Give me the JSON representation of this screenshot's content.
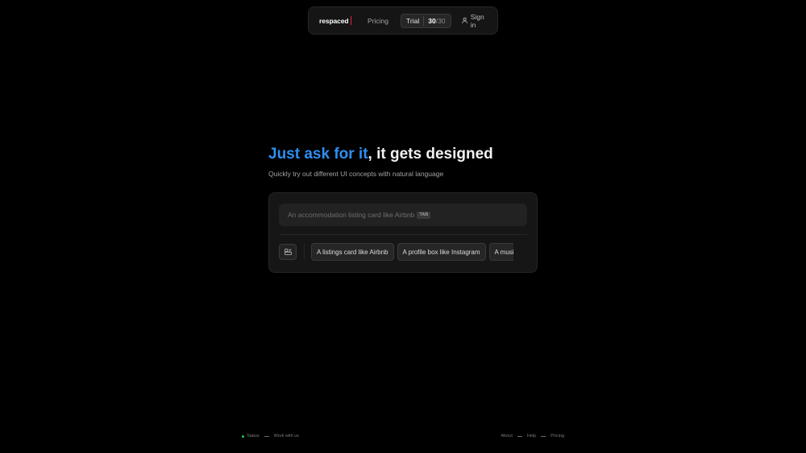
{
  "nav": {
    "logo": "respaced",
    "pricing": "Pricing",
    "trial_label": "Trial",
    "trial_count": "30",
    "trial_total": "/30",
    "signin": "Sign in",
    "signin_icon": "user-icon"
  },
  "hero": {
    "title_accent": "Just ask for it",
    "title_rest": ", it gets designed",
    "subtitle": "Quickly try out different UI concepts with natural language"
  },
  "prompt": {
    "placeholder": "An accommodation listing card like Airbnb",
    "tab_hint": "TAB",
    "image_icon": "image-upload-icon",
    "suggestions": [
      "A listings card like Airbnb",
      "A profile box like Instagram",
      "A music player like Spotify"
    ]
  },
  "footer": {
    "status": "Status",
    "work": "Work with us",
    "about": "About",
    "help": "Help",
    "pricing": "Pricing"
  },
  "colors": {
    "accent": "#2f8ff0",
    "logo_cursor": "#e0283a",
    "status_ok": "#22c55e"
  }
}
